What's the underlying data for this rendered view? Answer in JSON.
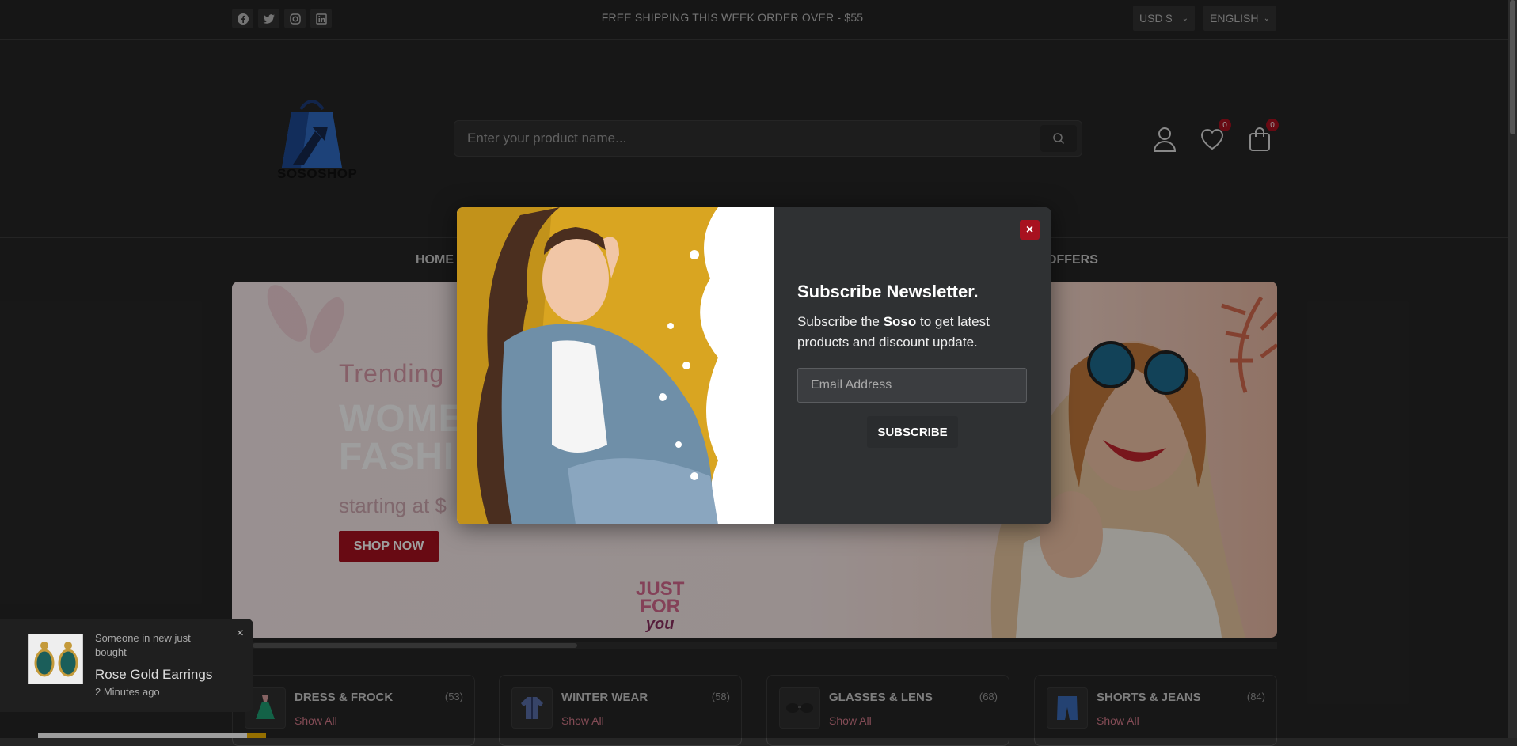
{
  "topbar": {
    "socials": [
      "facebook-icon",
      "twitter-icon",
      "instagram-icon",
      "linkedin-icon"
    ],
    "shipping": "FREE SHIPPING THIS WEEK ORDER OVER - $55",
    "currency": "USD $",
    "language": "ENGLISH"
  },
  "header": {
    "logo_text": "SOSOSHOP",
    "search_placeholder": "Enter your product name...",
    "wishlist_count": "0",
    "cart_count": "0"
  },
  "nav": {
    "home": "HOME",
    "offers": "OFFERS"
  },
  "hero": {
    "trending": "Trending",
    "headline_1": "WOME",
    "headline_2": "FASHI",
    "starting": "starting at $",
    "cta": "SHOP NOW",
    "badge_1": "JUST",
    "badge_2": "FOR",
    "badge_3": "you"
  },
  "categories": [
    {
      "name": "DRESS & FROCK",
      "count": "(53)",
      "link": "Show All",
      "icon": "dress-icon"
    },
    {
      "name": "WINTER WEAR",
      "count": "(58)",
      "link": "Show All",
      "icon": "jacket-icon"
    },
    {
      "name": "GLASSES & LENS",
      "count": "(68)",
      "link": "Show All",
      "icon": "glasses-icon"
    },
    {
      "name": "SHORTS & JEANS",
      "count": "(84)",
      "link": "Show All",
      "icon": "shorts-icon"
    }
  ],
  "modal": {
    "title": "Subscribe Newsletter.",
    "text_before": "Subscribe the ",
    "brand": "Soso",
    "text_after": " to get latest products and discount update.",
    "email_placeholder": "Email Address",
    "subscribe": "SUBSCRIBE",
    "close": "×"
  },
  "notification": {
    "line1": "Someone in new just bought",
    "product": "Rose Gold Earrings",
    "time": "2 Minutes ago",
    "close": "×"
  },
  "colors": {
    "accent": "#a8111f",
    "background": "#262626",
    "pink": "#d47a8a"
  }
}
